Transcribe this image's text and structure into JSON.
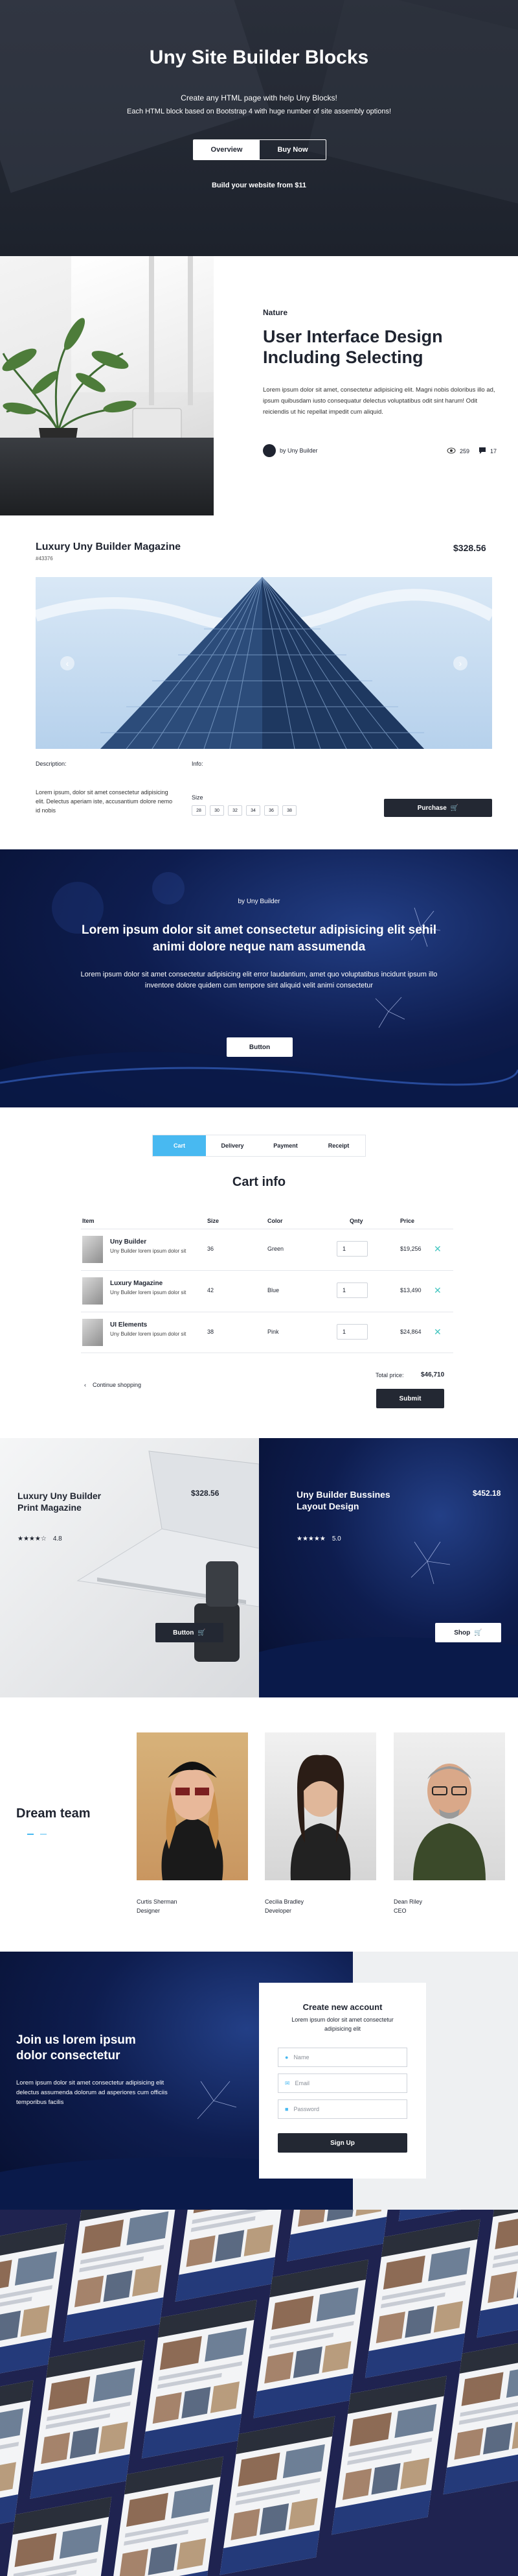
{
  "hero": {
    "title": "Uny Site Builder Blocks",
    "line1": "Create any HTML page with help Uny Blocks!",
    "line2": "Each HTML block based on Bootstrap 4 with huge number of site assembly options!",
    "tab_overview": "Overview",
    "tab_buy": "Buy Now",
    "footnote": "Build your website from $11"
  },
  "article": {
    "category": "Nature",
    "title": "User Interface Design Including Selecting",
    "body": "Lorem ipsum dolor sit amet, consectetur adipisicing elit. Magni nobis doloribus illo ad, ipsum quibusdam iusto consequatur delectus voluptatibus odit sint harum! Odit reiciendis ut hic repellat impedit cum aliquid.",
    "author": "by Uny Builder",
    "views": "259",
    "comments": "17"
  },
  "product": {
    "title": "Luxury Uny Builder Magazine",
    "sku": "#43376",
    "price": "$328.56",
    "description_label": "Description:",
    "description": "Lorem ipsum, dolor sit amet consectetur adipisicing elit. Delectus aperiam iste, accusantium dolore nemo id nobis",
    "info_label": "Info:",
    "size_label": "Size",
    "sizes": [
      "28",
      "30",
      "32",
      "34",
      "36",
      "38"
    ],
    "purchase_label": "Purchase"
  },
  "feature": {
    "byline": "by Uny Builder",
    "headline": "Lorem ipsum dolor sit amet consectetur adipisicing elit sehil animi dolore neque nam assumenda",
    "body": "Lorem ipsum dolor sit amet consectetur adipisicing elit error laudantium, amet quo voluptatibus incidunt ipsum illo inventore dolore quidem cum tempore sint aliquid velit animi consectetur",
    "button": "Button"
  },
  "cart": {
    "steps": [
      "Cart",
      "Delivery",
      "Payment",
      "Receipt"
    ],
    "title": "Cart info",
    "headers": {
      "item": "Item",
      "size": "Size",
      "color": "Color",
      "qty": "Qnty",
      "price": "Price"
    },
    "rows": [
      {
        "name": "Uny Builder",
        "desc": "Uny Builder lorem ipsum dolor sit",
        "size": "36",
        "color": "Green",
        "qty": "1",
        "price": "$19,256"
      },
      {
        "name": "Luxury Magazine",
        "desc": "Uny Builder lorem ipsum dolor sit",
        "size": "42",
        "color": "Blue",
        "qty": "1",
        "price": "$13,490"
      },
      {
        "name": "UI Elements",
        "desc": "Uny Builder lorem ipsum dolor sit",
        "size": "38",
        "color": "Pink",
        "qty": "1",
        "price": "$24,864"
      }
    ],
    "total_label": "Total price:",
    "total": "$46,710",
    "continue": "Continue shopping",
    "submit": "Submit"
  },
  "cards": {
    "left": {
      "title": "Luxury Uny Builder Print Magazine",
      "price": "$328.56",
      "rating": "4.8",
      "stars": 4,
      "button": "Button"
    },
    "right": {
      "title": "Uny Builder Bussines Layout Design",
      "price": "$452.18",
      "rating": "5.0",
      "stars": 5,
      "button": "Shop"
    }
  },
  "team": {
    "title": "Dream team",
    "members": [
      {
        "name": "Curtis Sherman",
        "role": "Designer"
      },
      {
        "name": "Cecilia Bradley",
        "role": "Developer"
      },
      {
        "name": "Dean Riley",
        "role": "CEO"
      }
    ]
  },
  "signup": {
    "headline": "Join us lorem ipsum dolor consectetur",
    "body": "Lorem ipsum dolor sit amet consectetur adipisicing elit delectus assumenda dolorum ad asperiores cum officiis temporibus facilis",
    "form_title": "Create new account",
    "form_sub": "Lorem ipsum dolor sit amet consectetur adipisicing elit",
    "name_ph": "Name",
    "email_ph": "Email",
    "password_ph": "Password",
    "button": "Sign Up"
  },
  "colors": {
    "accent": "#48b9f1",
    "dark": "#232833",
    "teal": "#44c6c0",
    "navy": "#0e1d4f"
  }
}
